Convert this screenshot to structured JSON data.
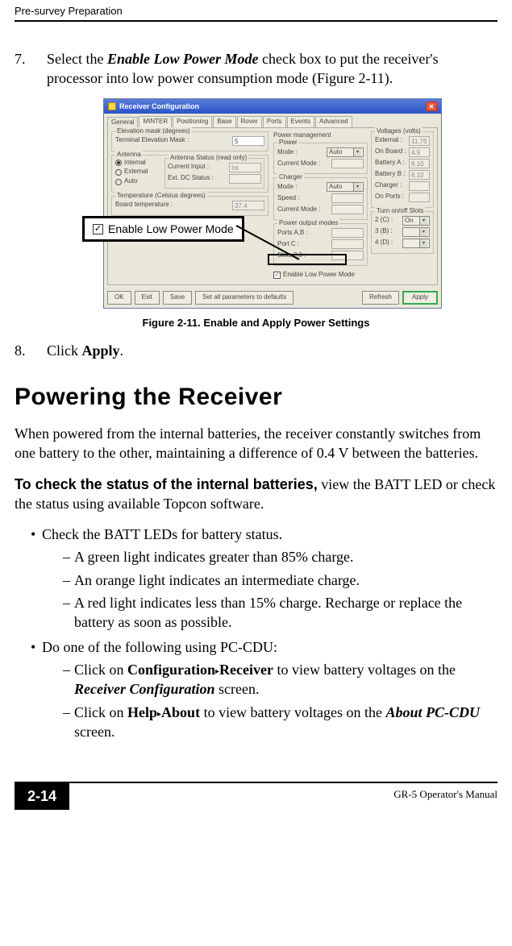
{
  "running_head": "Pre-survey Preparation",
  "step7": {
    "num": "7.",
    "pre": "Select the ",
    "bi": "Enable Low Power Mode",
    "mid": " check box to put the receiver's processor into low power consumption mode (Figure 2-11)."
  },
  "dialog": {
    "title": "Receiver Configuration",
    "close_glyph": "✕",
    "tabs": [
      "General",
      "MINTER",
      "Positioning",
      "Base",
      "Rover",
      "Ports",
      "Events",
      "Advanced"
    ],
    "grp_elev": {
      "title": "Elevation mask (degrees)",
      "row_label": "Terminal Elevation Mask :",
      "row_value": "5"
    },
    "grp_ant": {
      "title": "Antenna",
      "radios": [
        "Internal",
        "External",
        "Auto"
      ],
      "status_title": "Antenna Status (read only)",
      "ci_label": "Current Input :",
      "ci_value": "Int",
      "dc_label": "Ext. DC Status :",
      "dc_value": ""
    },
    "grp_temp": {
      "title": "Temperature (Celsius degrees)",
      "row_label": "Board temperature :",
      "row_value": "37.4"
    },
    "chk_lowpower": "Enable Low Power Mode",
    "chk_glyph": "✓",
    "pm_title": "Power management",
    "grp_power": {
      "title": "Power",
      "mode_l": "Mode :",
      "mode_v": "Auto",
      "cm_l": "Current Mode :",
      "cm_v": ""
    },
    "grp_charger": {
      "title": "Charger",
      "mode_l": "Mode :",
      "mode_v": "Auto",
      "sp_l": "Speed :",
      "sp_v": "",
      "cm_l": "Current Mode :",
      "cm_v": ""
    },
    "grp_pom": {
      "title": "Power output modes",
      "pa_l": "Ports A,B :",
      "pa_v": "",
      "pc_l": "Port C :",
      "pc_v": "",
      "sl_l": "Slots 2,3 :",
      "sl_v": ""
    },
    "grp_volt": {
      "title": "Voltages (volts)",
      "rows": [
        {
          "l": "External :",
          "v": "11.76"
        },
        {
          "l": "On Board :",
          "v": "4.9"
        },
        {
          "l": "Battery A :",
          "v": "8.10"
        },
        {
          "l": "Battery B :",
          "v": "8.10"
        },
        {
          "l": "Charger :",
          "v": ""
        },
        {
          "l": "On Ports :",
          "v": ""
        }
      ]
    },
    "grp_slot": {
      "title": "Turn on/off Slots",
      "rows": [
        {
          "l": "2 (C) :",
          "v": "On"
        },
        {
          "l": "3 (B) :",
          "v": ""
        },
        {
          "l": "4 (D) :",
          "v": ""
        }
      ]
    },
    "buttons": {
      "ok": "OK",
      "exit": "Exit",
      "save": "Save",
      "defaults": "Set all parameters to defaults",
      "refresh": "Refresh",
      "apply": "Apply"
    }
  },
  "callout": {
    "check_glyph": "✓",
    "label": "Enable Low Power Mode"
  },
  "fig_caption": "Figure 2-11. Enable and Apply Power Settings",
  "step8": {
    "num": "8.",
    "pre": "Click ",
    "b": "Apply",
    "post": "."
  },
  "h1": "Powering the Receiver",
  "p1": "When powered from the internal batteries, the receiver constantly switches from one battery to the other, maintaining a difference of 0.4 V between the batteries.",
  "p2_lead": "To check the status of the internal batteries,",
  "p2_rest": " view the BATT LED or check the status using available Topcon software.",
  "b1": "Check the BATT LEDs for battery status.",
  "b1d": [
    "A green light indicates greater than 85% charge.",
    "An orange light indicates an intermediate charge.",
    "A red light indicates less than 15% charge. Recharge or replace the battery as soon as possible."
  ],
  "b2": "Do one of the following using PC-CDU:",
  "b2d1": {
    "pre": "Click on ",
    "m1": "Configuration",
    "tri": "▸",
    "m2": "Receiver",
    "mid": " to view battery voltages on the ",
    "bi": "Receiver Configuration",
    "post": " screen."
  },
  "b2d2": {
    "pre": "Click on ",
    "m1": "Help",
    "tri": "▸",
    "m2": "About",
    "mid": " to view battery voltages on the ",
    "bi": "About PC-CDU",
    "post": " screen."
  },
  "page_num": "2-14",
  "footer_right": "GR-5 Operator's Manual"
}
